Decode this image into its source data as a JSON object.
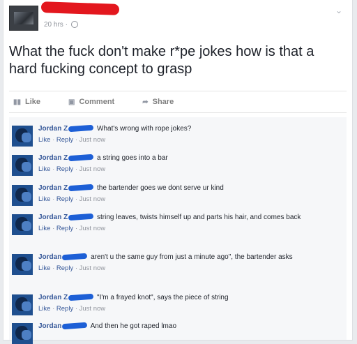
{
  "post": {
    "timestamp": "20 hrs ·",
    "text": "What the fuck don't make r*pe jokes how is that a hard fucking concept to grasp"
  },
  "actions": {
    "like": "Like",
    "comment": "Comment",
    "share": "Share"
  },
  "comment_labels": {
    "like": "Like",
    "reply": "Reply",
    "time": "Just now"
  },
  "comments": [
    {
      "name": "Jordan Z",
      "text": "What's wrong with rope jokes?"
    },
    {
      "name": "Jordan Z",
      "text": "a string goes into a bar"
    },
    {
      "name": "Jordan Z",
      "text": "the bartender goes we dont serve ur kind"
    },
    {
      "name": "Jordan Z",
      "text": "string leaves, twists himself up and parts his hair, and comes back"
    },
    {
      "name": "Jordan",
      "text": "aren't u the same guy from just a minute ago\", the bartender asks"
    },
    {
      "name": "Jordan Z",
      "text": "\"I'm a frayed knot\", says the piece of string"
    },
    {
      "name": "Jordan",
      "text": "And then he got raped lmao"
    }
  ]
}
